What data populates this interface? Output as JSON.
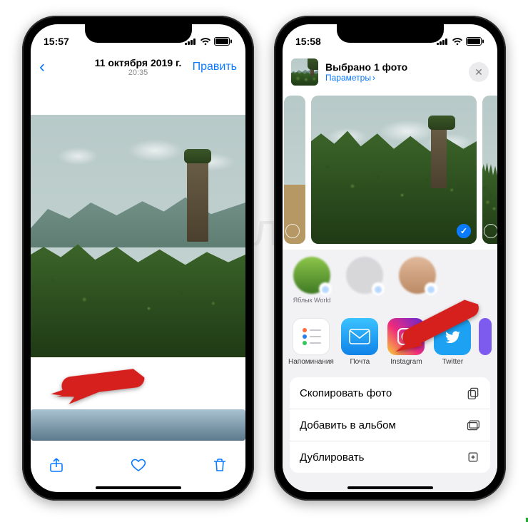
{
  "watermark": "Яблык",
  "left": {
    "status_time": "15:57",
    "nav": {
      "date": "11 октября 2019 г.",
      "time": "20:35",
      "edit": "Править"
    },
    "toolbar": {
      "share_icon": "share-icon",
      "like_icon": "heart-icon",
      "trash_icon": "trash-icon"
    }
  },
  "right": {
    "status_time": "15:58",
    "sheet": {
      "title": "Выбрано 1 фото",
      "params": "Параметры",
      "close_icon": "close-icon"
    },
    "airdrop": [
      {
        "name": "Яблык World"
      },
      {
        "name": ""
      },
      {
        "name": ""
      }
    ],
    "apps": [
      {
        "name": "Напоминания",
        "icon": "reminders-icon"
      },
      {
        "name": "Почта",
        "icon": "mail-icon"
      },
      {
        "name": "Instagram",
        "icon": "instagram-icon"
      },
      {
        "name": "Twitter",
        "icon": "twitter-icon"
      }
    ],
    "actions": [
      {
        "label": "Скопировать фото",
        "icon": "copy-icon"
      },
      {
        "label": "Добавить в альбом",
        "icon": "album-icon"
      },
      {
        "label": "Дублировать",
        "icon": "duplicate-icon"
      }
    ]
  }
}
